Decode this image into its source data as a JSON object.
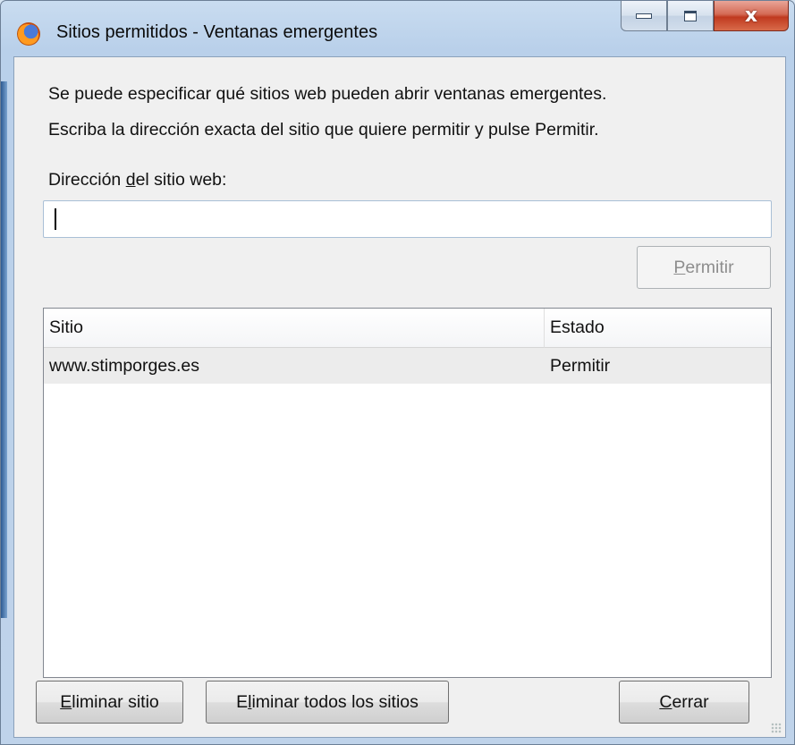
{
  "window": {
    "title": "Sitios permitidos - Ventanas emergentes",
    "app_icon": "firefox-icon",
    "controls": {
      "minimize": "minimize-icon",
      "maximize": "maximize-icon",
      "close": "x"
    }
  },
  "intro": {
    "line1": "Se puede especificar qué sitios web pueden abrir ventanas emergentes.",
    "line2": "Escriba la dirección exacta del sitio que quiere permitir y pulse Permitir."
  },
  "address": {
    "label_before": "Dirección ",
    "label_mnemonic": "d",
    "label_after": "el sitio web:",
    "value": "",
    "placeholder": ""
  },
  "allow_button": {
    "mnemonic": "P",
    "rest": "ermitir",
    "enabled": false
  },
  "sites_table": {
    "headers": {
      "site": "Sitio",
      "state": "Estado"
    },
    "rows": [
      {
        "site": "www.stimporges.es",
        "state": "Permitir"
      }
    ]
  },
  "footer": {
    "remove": {
      "mnemonic": "E",
      "rest": "liminar sitio"
    },
    "remove_all": {
      "before": "E",
      "mnemonic": "l",
      "rest": "iminar todos los sitios"
    },
    "close": {
      "mnemonic": "C",
      "rest": "errar"
    }
  },
  "colors": {
    "accent": "#c0391f",
    "selection_row": "#ececec",
    "frame": "#bfd3ea"
  }
}
